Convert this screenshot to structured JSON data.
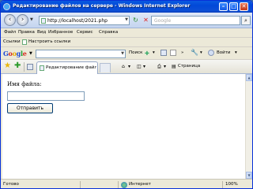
{
  "window": {
    "title": "Редактирование файлов на сервере - Windows Internet Explorer",
    "controls": {
      "minimize": "–",
      "maximize": "□",
      "close": "✕"
    }
  },
  "address_bar": {
    "url": "http://localhost/2021.php",
    "live_search_placeholder": "Google"
  },
  "menu": [
    "Файл",
    "Правка",
    "Вид",
    "Избранное",
    "Сервис",
    "Справка"
  ],
  "links_bar": {
    "label": "Ссылки",
    "items": [
      "Настроить ссылки"
    ]
  },
  "google_toolbar": {
    "logo": [
      "G",
      "o",
      "o",
      "g",
      "l",
      "e"
    ],
    "search_label": "Поиск",
    "more_label": "»",
    "settings_label": "Войти"
  },
  "tabs": {
    "active_title": "Редактирование файлов на сервере",
    "page_menu": "Страница"
  },
  "form": {
    "label": "Имя файла:",
    "input_value": "",
    "submit_label": "Отправить"
  },
  "status": {
    "text": "Готово",
    "zone": "Интернет",
    "zoom": "100%"
  }
}
